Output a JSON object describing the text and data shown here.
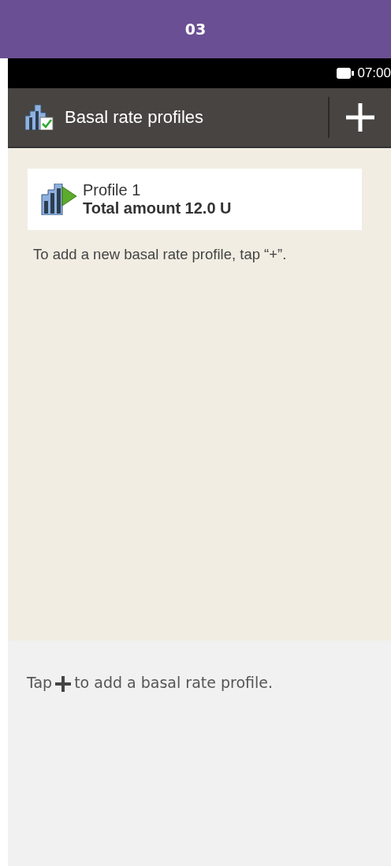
{
  "step": "03",
  "status_bar": {
    "time": "07:00"
  },
  "header": {
    "title": "Basal rate profiles"
  },
  "profiles": [
    {
      "name": "Profile 1",
      "total": "Total amount 12.0 U"
    }
  ],
  "hint": "To add a new basal rate profile, tap “+”.",
  "instruction": {
    "before": "Tap",
    "after": "to add a basal rate profile."
  }
}
